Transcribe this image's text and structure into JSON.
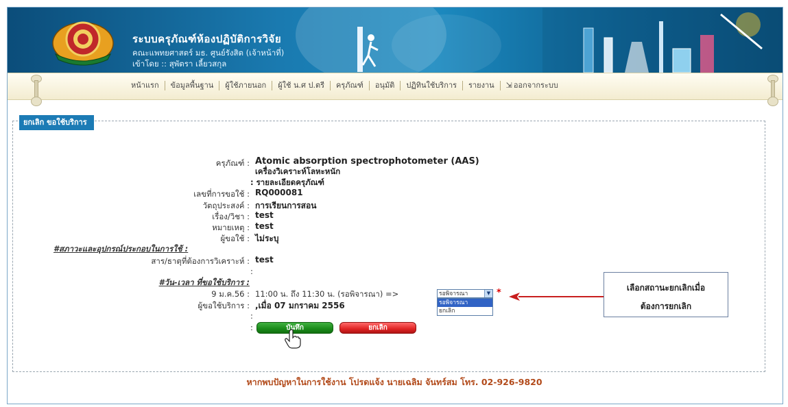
{
  "header": {
    "system_title": "ระบบครุภัณฑ์ห้องปฏิบัติการวิจัย",
    "faculty_line": "คณะแพทยศาสตร์ มธ. ศูนย์รังสิต (เจ้าหน้าที่)",
    "login_line": "เข้าโดย :: สุพัตรา เลี้ยวสกุล"
  },
  "nav": {
    "items": [
      "หน้าแรก",
      "ข้อมูลพื้นฐาน",
      "ผู้ใช้ภายนอก",
      "ผู้ใช้ น.ศ ป.ตรี",
      "ครุภัณฑ์",
      "อนุมัติ",
      "ปฏิทินใช้บริการ",
      "รายงาน",
      "ออกจากระบบ"
    ]
  },
  "panel": {
    "legend": "ยกเลิก ขอใช้บริการ"
  },
  "form": {
    "equipment_label": "ครุภัณฑ์ :",
    "equipment_name": "Atomic absorption spectrophotometer (AAS)",
    "equipment_desc": "เครื่องวิเคราะห์โลหะหนัก",
    "details_link": ": รายละเอียดครุภัณฑ์",
    "request_no_label": "เลขที่การขอใช้ :",
    "request_no": "RQ000081",
    "purpose_label": "วัตถุประสงค์ :",
    "purpose": "การเรียนการสอน",
    "subject_label": "เรื่อง/วิชา :",
    "subject": "test",
    "note_label": "หมายเหตุ :",
    "note": "test",
    "requester_label": "ผู้ขอใช้ :",
    "requester": "ไม่ระบุ",
    "conditions_label": "#สภาวะและอุปกรณ์ประกอบในการใช้ :",
    "substance_label": "สาร/ธาตุที่ต้องการวิเคราะห์ :",
    "substance": "test",
    "datetime_label": "#วัน-เวลา ที่ขอใช้บริการ :",
    "date_label": "9 ม.ค.56 :",
    "time_text": "11:00 น. ถึง 11:30 น. (รอพิจารณา) =>",
    "service_user_label": "ผู้ขอใช้บริการ :",
    "service_user": ",เมื่อ 07 มกราคม 2556"
  },
  "status_select": {
    "value": "รอพิจารณา",
    "options": [
      "รอพิจารณา",
      "ยกเลิก"
    ],
    "required_mark": "*"
  },
  "buttons": {
    "save": "บันทึก",
    "cancel": "ยกเลิก"
  },
  "callout": {
    "line1": "เลือกสถานะยกเลิกเมื่อ",
    "line2": "ต้องการยกเลิก"
  },
  "footer": {
    "text": "หากพบปัญหาในการใช้งาน โปรดแจ้ง นายเฉลิม จันทร์สม โทร. 02-926-9820"
  },
  "colors": {
    "header_blue": "#1a7ab0",
    "legend_blue": "#1c7bb5",
    "save_green": "#1a8a1a",
    "cancel_red": "#e02424",
    "footer_text": "#b24a1a",
    "arrow_red": "#c81e1e"
  }
}
